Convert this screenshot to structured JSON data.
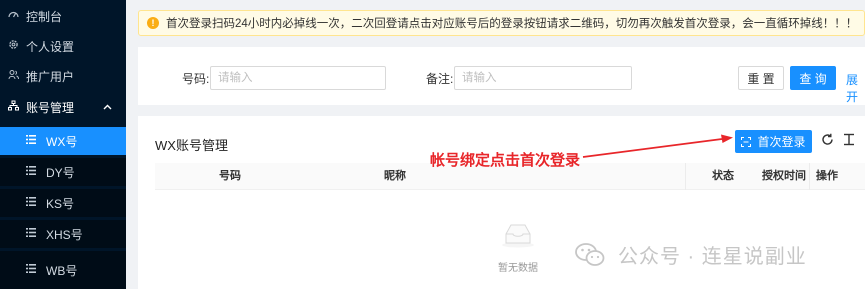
{
  "sidebar": {
    "items": [
      {
        "label": "控制台",
        "icon": "dashboard-icon"
      },
      {
        "label": "个人设置",
        "icon": "gear-icon"
      },
      {
        "label": "推广用户",
        "icon": "users-icon"
      }
    ],
    "group": {
      "label": "账号管理",
      "icon": "sitemap-icon",
      "expanded": true
    },
    "sub_items": [
      {
        "label": "WX号",
        "icon": "list-icon",
        "active": true
      },
      {
        "label": "DY号",
        "icon": "list-icon"
      },
      {
        "label": "KS号",
        "icon": "list-icon"
      },
      {
        "label": "XHS号",
        "icon": "list-icon"
      },
      {
        "label": "WB号",
        "icon": "list-icon"
      }
    ]
  },
  "notice": {
    "text": "首次登录扫码24小时内必掉线一次，二次回登请点击对应账号后的登录按钮请求二维码，切勿再次触发首次登录，会一直循环掉线！！！"
  },
  "search": {
    "account_label": "号码:",
    "account_placeholder": "请输入",
    "remark_label": "备注:",
    "remark_placeholder": "请输入",
    "reset_label": "重 置",
    "query_label": "查 询",
    "expand_label": "展开"
  },
  "table": {
    "title": "WX账号管理",
    "first_login_label": "首次登录",
    "columns": [
      "号码",
      "昵称",
      "状态",
      "授权时间",
      "操作"
    ],
    "empty_text": "暂无数据"
  },
  "annotation": {
    "text": "帐号绑定点击首次登录"
  },
  "watermark": {
    "text": "公众号 · 连星说副业"
  },
  "colors": {
    "sidebar_bg": "#001529",
    "primary": "#1890ff",
    "annotation": "#e8262a",
    "notice_bg": "#fffbe6"
  }
}
